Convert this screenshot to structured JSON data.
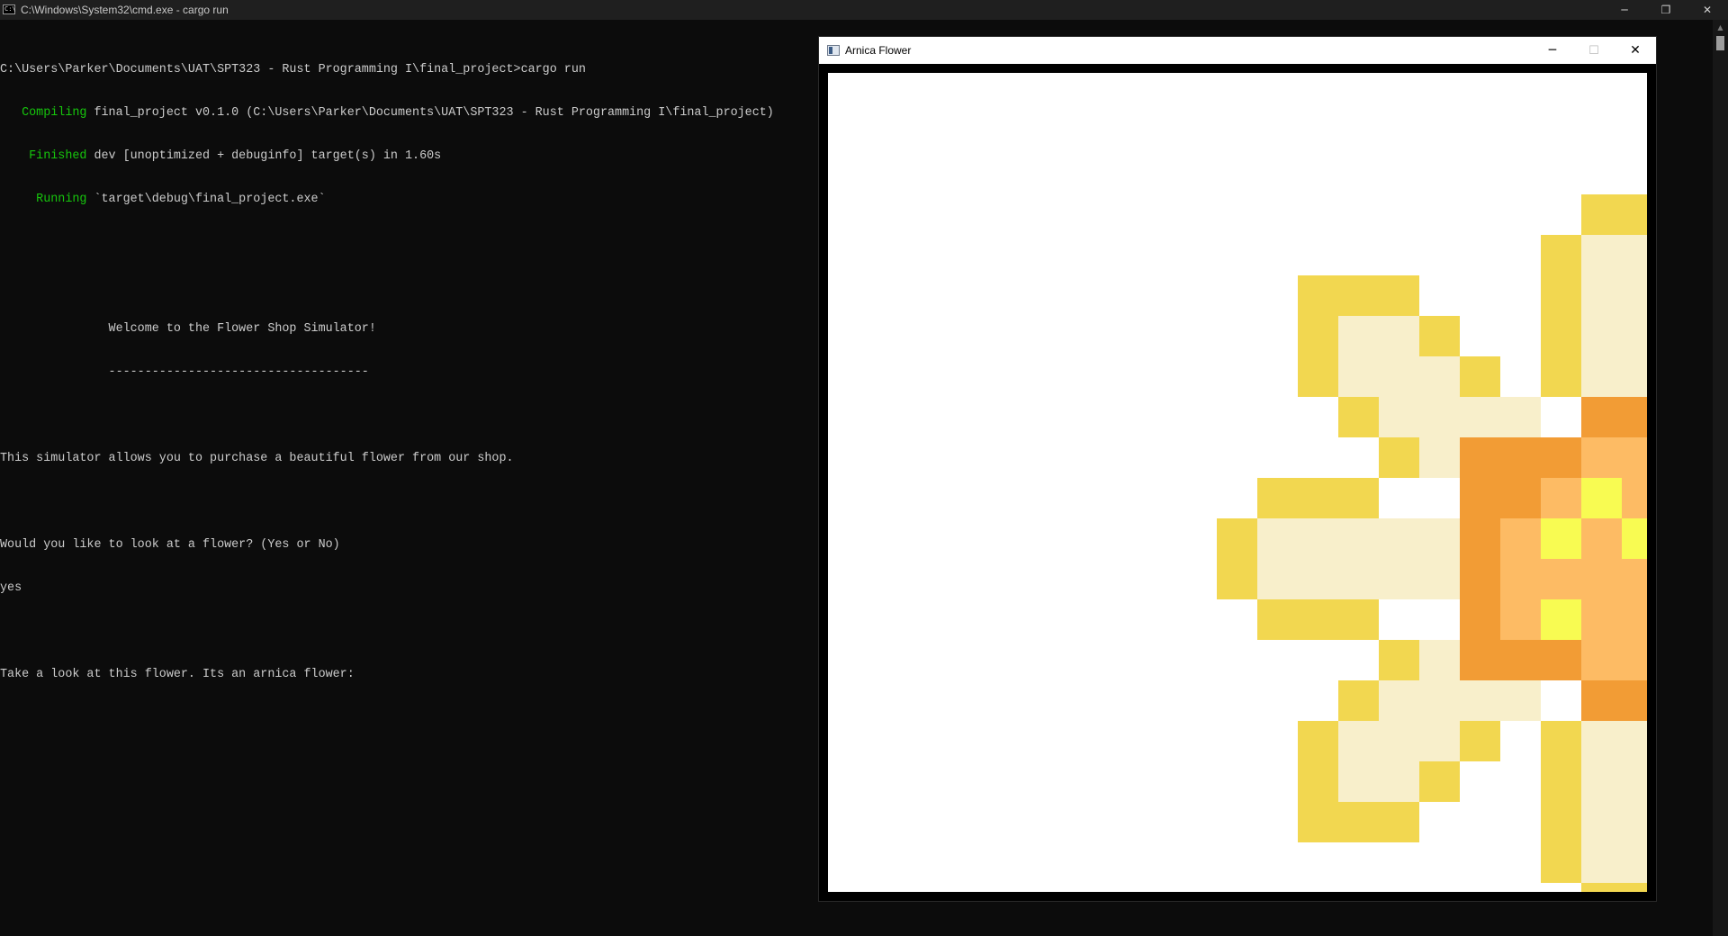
{
  "console_window": {
    "title": "C:\\Windows\\System32\\cmd.exe - cargo  run",
    "icon_text": "C:\\",
    "buttons": {
      "minimize": "─",
      "maximize": "❐",
      "close": "✕"
    }
  },
  "console": {
    "prompt": "C:\\Users\\Parker\\Documents\\UAT\\SPT323 - Rust Programming I\\final_project>cargo run",
    "compile_lines": [
      {
        "status": "   Compiling",
        "text": " final_project v0.1.0 (C:\\Users\\Parker\\Documents\\UAT\\SPT323 - Rust Programming I\\final_project)"
      },
      {
        "status": "    Finished",
        "text": " dev [unoptimized + debuginfo] target(s) in 1.60s"
      },
      {
        "status": "     Running",
        "text": " `target\\debug\\final_project.exe`"
      }
    ],
    "welcome": "               Welcome to the Flower Shop Simulator!",
    "underline": "               ------------------------------------",
    "intro": "This simulator allows you to purchase a beautiful flower from our shop.",
    "question": "Would you like to look at a flower? (Yes or No)",
    "answer": "yes",
    "result": "Take a look at this flower. Its an arnica flower:"
  },
  "flower_window": {
    "title": "Arnica Flower",
    "buttons": {
      "minimize": "─",
      "maximize": "☐",
      "close": "✕"
    }
  },
  "flower": {
    "palette": {
      "y": "#f2d750",
      "c": "#f8efcb",
      "o": "#f29c35",
      "l": "#fdbb64",
      "b": "#f8fb52",
      "w": "#ffffff"
    },
    "pixels": [
      "wwwwwwwwwwwwwwwwwwwwwwwwwwwwwwwwwwwww",
      "wwwwwwwwwwwwwwwwwwwwwwwwwwwwwwwwwwwww",
      "wwwwwwwwwwwwwwwwwwwwwwwwwwwwwwwwwwwww",
      "wwwwwwwwwwwwwwwwwyyywwwwwwwwwwwwwwwww",
      "wwwwwwwwwwwwwwwwycccywwwwwwwwwwwwwwww",
      "wwwwwwwwwwyyywwwycccywwwwwyyywwwwwwww",
      "wwwwwwwwwwyccywwycccywwwwyccyyywwwwww",
      "wwwwwwwwwwycccywycccywwwycccccywwwwww",
      "wwwwwwwwwwwyccccwooowwwccccyywwwwwwww",
      "wwwwwwwwwwwwycooollloooccywwwwwwwwwww",
      "wwwwwwwwwyyywwoolbllbowwyyywwwwwwwwww",
      "wwwwwwwwycccccolblbllocccccywwwwwwwww",
      "wwwwwwwwycccccolllllbocccccywwwwwwwww",
      "wwwwwwwwwyyywwolblllowwyyywwwwwwwwwww",
      "wwwwwwwwwwwwycooollloooccywwwwwwwwwww",
      "wwwwwwwwwwwyccccwooowwwccccywwwwwwwww",
      "wwwwwwwwwwycccywycccywwwycccywwwwwwww",
      "wwwwwwwwwwyccywwycccywwwwyccywwwwwwww",
      "wwwwwwwwwwyyywwwycccywwwwwyyywwwwwwww",
      "wwwwwwwwwwwwwwwwycccywwwwwwwwwwwwwwww",
      "wwwwwwwwwwwwwwwwwyyywwwwwwwwwwwwwwwww",
      "wwwwwwwwwwwwwwwwwwwwwwwwwwwwwwwwwwwww",
      "wwwwwwwwwwwwwwwwwwwwwwwwwwwwwwwwwwwww"
    ]
  }
}
